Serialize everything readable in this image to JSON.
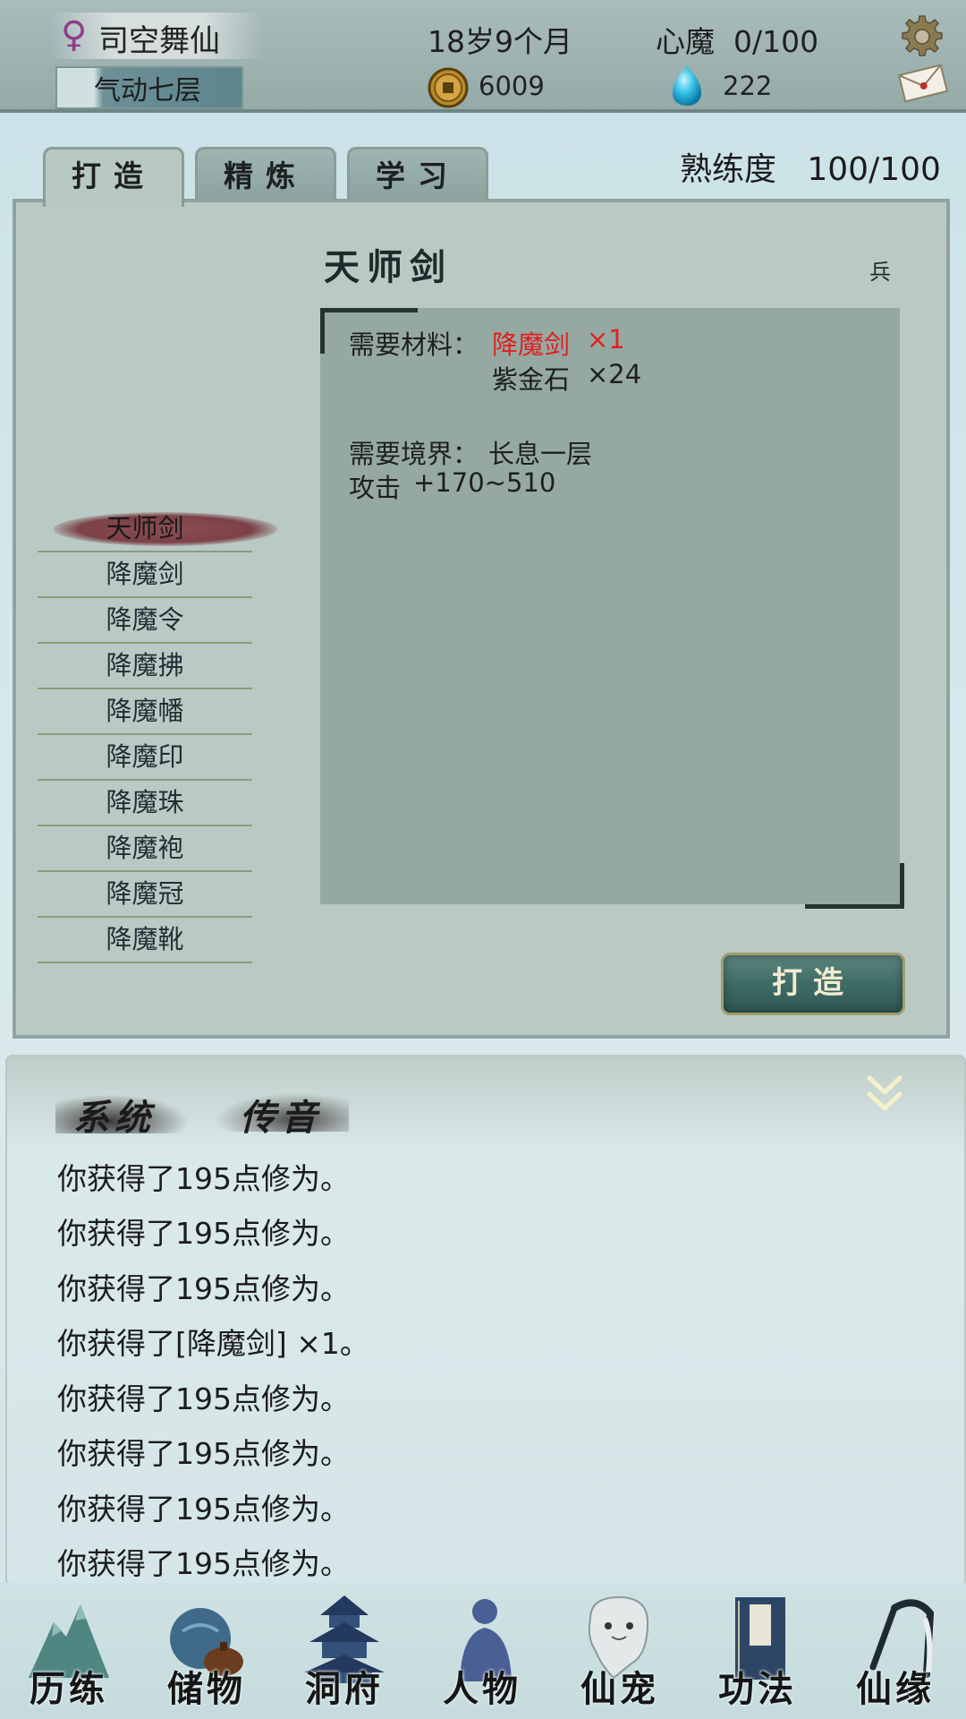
{
  "header": {
    "player_name": "司空舞仙",
    "gender_symbol": "♀",
    "realm": "气动七层",
    "age": "18岁9个月",
    "heart_demon_label": "心魔",
    "heart_demon_value": "0/100",
    "coins": "6009",
    "gems": "222"
  },
  "tabs": [
    {
      "label": "打造",
      "active": true
    },
    {
      "label": "精炼",
      "active": false
    },
    {
      "label": "学习",
      "active": false
    }
  ],
  "proficiency": {
    "label": "熟练度",
    "value": "100/100"
  },
  "item": {
    "title": "天师剑",
    "type_glyph": "兵",
    "materials_label": "需要材料：",
    "materials": [
      {
        "name": "降魔剑",
        "qty": "×1",
        "lacking": true
      },
      {
        "name": "紫金石",
        "qty": "×24",
        "lacking": false
      }
    ],
    "realm_req_label": "需要境界：",
    "realm_req": "长息一层",
    "attack_label": "攻击",
    "attack": "+170~510"
  },
  "recipes": [
    {
      "name": "天师剑",
      "selected": true
    },
    {
      "name": "降魔剑",
      "selected": false
    },
    {
      "name": "降魔令",
      "selected": false
    },
    {
      "name": "降魔拂",
      "selected": false
    },
    {
      "name": "降魔幡",
      "selected": false
    },
    {
      "name": "降魔印",
      "selected": false
    },
    {
      "name": "降魔珠",
      "selected": false
    },
    {
      "name": "降魔袍",
      "selected": false
    },
    {
      "name": "降魔冠",
      "selected": false
    },
    {
      "name": "降魔靴",
      "selected": false
    }
  ],
  "forge_button": "打造",
  "chat": {
    "tabs": [
      "系统",
      "传音"
    ],
    "messages": [
      "你获得了195点修为。",
      "你获得了195点修为。",
      "你获得了195点修为。",
      "你获得了[降魔剑] ×1。",
      "你获得了195点修为。",
      "你获得了195点修为。",
      "你获得了195点修为。",
      "你获得了195点修为。"
    ]
  },
  "nav": [
    {
      "label": "历练",
      "icon": "mountain-icon"
    },
    {
      "label": "储物",
      "icon": "bag-icon"
    },
    {
      "label": "洞府",
      "icon": "pagoda-icon"
    },
    {
      "label": "人物",
      "icon": "person-icon"
    },
    {
      "label": "仙宠",
      "icon": "spirit-pet-icon"
    },
    {
      "label": "功法",
      "icon": "scroll-book-icon"
    },
    {
      "label": "仙缘",
      "icon": "crane-icon"
    }
  ],
  "colors": {
    "lacking_material": "#e02020",
    "panel_bg": "#b9cac4",
    "detail_bg": "#95a9a2",
    "topbar_bg": "#a8bcba"
  }
}
